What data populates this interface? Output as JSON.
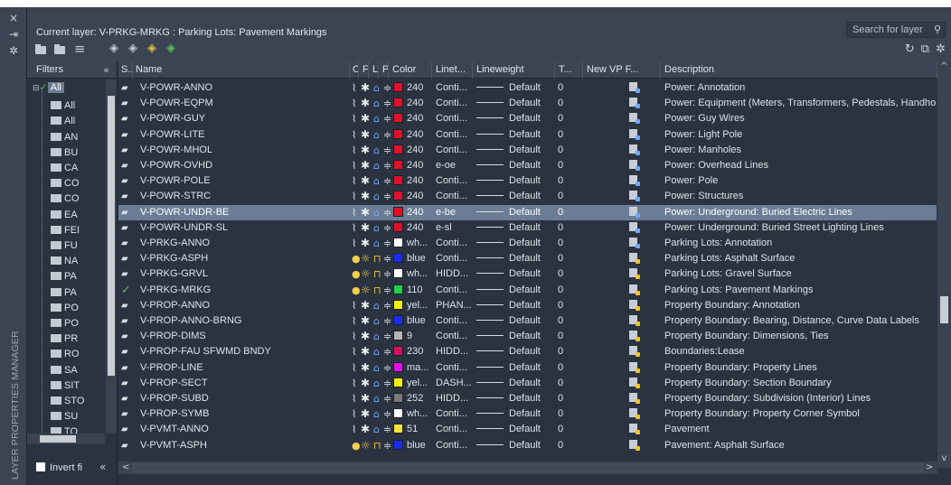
{
  "window": {
    "vertical_title": "LAYER PROPERTIES MANAGER",
    "close_glyph": "×",
    "pin_glyph": "⇥",
    "gear_glyph": "✲"
  },
  "header": {
    "current_layer": "Current layer: V-PRKG-MRKG : Parking Lots: Pavement Markings",
    "search_placeholder": "Search for layer",
    "search_icon": "magnifier-icon"
  },
  "filters": {
    "heading": "Filters",
    "collapse_glyph": "«",
    "tree": [
      "All",
      "All",
      "All",
      "AN",
      "BU",
      "CA",
      "CO",
      "CO",
      "EA",
      "FEI",
      "FU",
      "NA",
      "PA",
      "PA",
      "PO",
      "PO",
      "PR",
      "RO",
      "SA",
      "SIT",
      "STO",
      "SU",
      "TO"
    ],
    "invert_label": "Invert fi",
    "invert_collapse": "«"
  },
  "columns": [
    "S..",
    "Name",
    "O..",
    "F..",
    "L..",
    "P..",
    "Color",
    "Linet...",
    "Lineweight",
    "T...",
    "New VP F...",
    "Description"
  ],
  "layers": [
    {
      "status": "pen",
      "name": "V-POWR-ANNO",
      "color": "240",
      "swatch": "#e0102a",
      "linetype": "Conti...",
      "lw": "Default",
      "t": "0",
      "desc": "Power: Annotation"
    },
    {
      "status": "pen",
      "name": "V-POWR-EQPM",
      "color": "240",
      "swatch": "#e0102a",
      "linetype": "Conti...",
      "lw": "Default",
      "t": "0",
      "desc": "Power: Equipment (Meters, Transformers, Pedestals, Handho"
    },
    {
      "status": "pen",
      "name": "V-POWR-GUY",
      "color": "240",
      "swatch": "#e0102a",
      "linetype": "Conti...",
      "lw": "Default",
      "t": "0",
      "desc": "Power: Guy Wires"
    },
    {
      "status": "pen",
      "name": "V-POWR-LITE",
      "color": "240",
      "swatch": "#e0102a",
      "linetype": "Conti...",
      "lw": "Default",
      "t": "0",
      "desc": "Power: Light Pole"
    },
    {
      "status": "pen",
      "name": "V-POWR-MHOL",
      "color": "240",
      "swatch": "#e0102a",
      "linetype": "Conti...",
      "lw": "Default",
      "t": "0",
      "desc": "Power: Manholes"
    },
    {
      "status": "pen",
      "name": "V-POWR-OVHD",
      "color": "240",
      "swatch": "#e0102a",
      "linetype": "e-oe",
      "lw": "Default",
      "t": "0",
      "desc": "Power: Overhead Lines"
    },
    {
      "status": "pen",
      "name": "V-POWR-POLE",
      "color": "240",
      "swatch": "#e0102a",
      "linetype": "Conti...",
      "lw": "Default",
      "t": "0",
      "desc": "Power: Pole"
    },
    {
      "status": "pen",
      "name": "V-POWR-STRC",
      "color": "240",
      "swatch": "#e0102a",
      "linetype": "Conti...",
      "lw": "Default",
      "t": "0",
      "desc": "Power: Structures"
    },
    {
      "status": "pen",
      "name": "V-POWR-UNDR-BE",
      "color": "240",
      "swatch": "#e0102a",
      "linetype": "e-be",
      "lw": "Default",
      "t": "0",
      "desc": "Power: Underground: Buried Electric Lines",
      "selected": true
    },
    {
      "status": "pen",
      "name": "V-POWR-UNDR-SL",
      "color": "240",
      "swatch": "#e0102a",
      "linetype": "e-sl",
      "lw": "Default",
      "t": "0",
      "desc": "Power: Underground: Buried Street Lighting Lines"
    },
    {
      "status": "pen",
      "name": "V-PRKG-ANNO",
      "color": "wh...",
      "swatch": "#ffffff",
      "linetype": "Conti...",
      "lw": "Default",
      "t": "0",
      "desc": "Parking Lots: Annotation"
    },
    {
      "status": "pen",
      "name": "V-PRKG-ASPH",
      "color": "blue",
      "swatch": "#1b2cf0",
      "linetype": "Conti...",
      "lw": "Default",
      "t": "0",
      "desc": "Parking Lots: Asphalt Surface",
      "yellow": true
    },
    {
      "status": "pen",
      "name": "V-PRKG-GRVL",
      "color": "wh...",
      "swatch": "#ffffff",
      "linetype": "HIDD...",
      "lw": "Default",
      "t": "0",
      "desc": "Parking Lots: Gravel Surface",
      "yellow": true
    },
    {
      "status": "check",
      "name": "V-PRKG-MRKG",
      "color": "110",
      "swatch": "#18d24a",
      "linetype": "Conti...",
      "lw": "Default",
      "t": "0",
      "desc": "Parking Lots: Pavement Markings",
      "yellow": true
    },
    {
      "status": "pen",
      "name": "V-PROP-ANNO",
      "color": "yel...",
      "swatch": "#f2ee10",
      "linetype": "PHAN...",
      "lw": "Default",
      "t": "0",
      "desc": "Property Boundary: Annotation"
    },
    {
      "status": "pen",
      "name": "V-PROP-ANNO-BRNG",
      "color": "blue",
      "swatch": "#1b2cf0",
      "linetype": "Conti...",
      "lw": "Default",
      "t": "0",
      "desc": "Property Boundary: Bearing, Distance, Curve Data Labels"
    },
    {
      "status": "pen",
      "name": "V-PROP-DIMS",
      "color": "9",
      "swatch": "#b5b5b5",
      "linetype": "Conti...",
      "lw": "Default",
      "t": "0",
      "desc": "Property Boundary: Dimensions, Ties"
    },
    {
      "status": "pen",
      "name": "V-PROP-FAU SFWMD BNDY",
      "color": "230",
      "swatch": "#d8105e",
      "linetype": "HIDD...",
      "lw": "Default",
      "t": "0",
      "desc": "Boundaries:Lease"
    },
    {
      "status": "pen",
      "name": "V-PROP-LINE",
      "color": "ma...",
      "swatch": "#e210e2",
      "linetype": "Conti...",
      "lw": "Default",
      "t": "0",
      "desc": "Property Boundary: Property Lines"
    },
    {
      "status": "pen",
      "name": "V-PROP-SECT",
      "color": "yel...",
      "swatch": "#f2ee10",
      "linetype": "DASH...",
      "lw": "Default",
      "t": "0",
      "desc": "Property Boundary: Section Boundary"
    },
    {
      "status": "pen",
      "name": "V-PROP-SUBD",
      "color": "252",
      "swatch": "#7a7a7a",
      "linetype": "HIDD...",
      "lw": "Default",
      "t": "0",
      "desc": "Property Boundary: Subdivision (Interior) Lines"
    },
    {
      "status": "pen",
      "name": "V-PROP-SYMB",
      "color": "wh...",
      "swatch": "#ffffff",
      "linetype": "Conti...",
      "lw": "Default",
      "t": "0",
      "desc": "Property Boundary: Property Corner Symbol"
    },
    {
      "status": "pen",
      "name": "V-PVMT-ANNO",
      "color": "51",
      "swatch": "#f2e23a",
      "linetype": "Conti...",
      "lw": "Default",
      "t": "0",
      "desc": "Pavement"
    },
    {
      "status": "pen",
      "name": "V-PVMT-ASPH",
      "color": "blue",
      "swatch": "#1b2cf0",
      "linetype": "Conti...",
      "lw": "Default",
      "t": "0",
      "desc": "Pavement: Asphalt Surface",
      "yellow": true
    }
  ]
}
